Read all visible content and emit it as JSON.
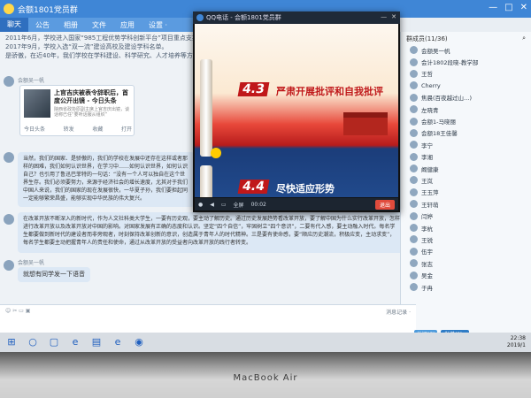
{
  "window": {
    "title": "会额1801党员群"
  },
  "tabs": [
    {
      "label": "聊天"
    },
    {
      "label": "公告"
    },
    {
      "label": "相册"
    },
    {
      "label": "文件"
    },
    {
      "label": "应用"
    },
    {
      "label": "设置 ·"
    }
  ],
  "chat": {
    "line1": "2011年6月，学校进入国家“985工程优势学科创新平台”项目重点支持",
    "line2": "2017年9月，学校入选“双一流”建设高校及建设学科名单。",
    "line3": "是骄傲，在近40年，我们学校在学科建设、科学研究、人才培养等方面",
    "sender1": "会额吴一帆",
    "news": {
      "title": "上官吉庆被表令辞职后，首度公开出镜 - 今日头条",
      "subtitle": "陕西省政协原副主席上官吉庆出镜，谈话称已任“要听话服从组织”",
      "source": "今日头条",
      "actions": [
        "转发",
        "收藏",
        "打开"
      ]
    },
    "para1": "当然，我们的国家、是骄傲的，我们的学校在发展中还存在这样或者那样的困难，我们如何认识世界，在学习中……如何认识世界，如何认识自己？也引用了鲁迅巴菲特的一句话：“没有一个人可以独自在这个世界生存。我们必须要努力，来源于经济社会的增长速度，尤其对于我们中国人来说，我们的国家的现在发展很快，一华夏子孙，我们要担起同一定能够繁荣昌盛，能够实现中华民族的伟大复兴。",
    "para2": "在改革开放不断深入的新时代，作为人文社科类大学生，一要有历史观，要主动了解历史。通过历史发展趋势看改革开放，要了解中国为什么实行改革开放，怎样进行改革开放以及改革开放对中国的影响。对国家发展有正确的态度和认识。坚定“四个自信”，牢固树立“四个意识”，二要有代入感，要主动融入时代。每名学生都要做到新时代的建设者而非旁观者，时刻保持改革创新的意识，创造属于青年人的时代精神。三是要有使命感，要“顺应历史潮流，积极应变，主动求变”，每名学生都要主动把握青年人的责任和使命，通过从改革开放的受益者向改革开放的践行者转变。",
    "sender2": "会额吴一帆",
    "bubble3": "就想有同学发一下语音"
  },
  "video": {
    "title": "QQ电话 - 会额1801党员群",
    "slide_num1": "4.3",
    "slide_title1": "严肃开展批评和自我批评",
    "slide_num2": "4.4",
    "slide_title2": "尽快适应形势",
    "fullscreen": "全屏",
    "timer": "00:02",
    "end_label": "退出"
  },
  "members": {
    "header": "群成员(11/36)",
    "list": [
      "会额吴一帆",
      "会计1802段晓-教学部",
      "王哲",
      "Cherry",
      "焦晨(百夜越过山…)",
      "左晓青",
      "会额1-马晓丽",
      "会额18王佳馨",
      "李宁",
      "李湘",
      "阚健康",
      "王岚",
      "王玉萍",
      "王轩萌",
      "闫婷",
      "李杭",
      "王锐",
      "伍宇",
      "张志",
      "吴金",
      "于冉"
    ]
  },
  "input": {
    "record_label": "消息记录 ·",
    "close_label": "关闭(C)",
    "send_label": "发送(S) ·"
  },
  "taskbar": {
    "time": "22:38",
    "date": "2019/1"
  },
  "laptop": {
    "brand": "MacBook Air"
  }
}
